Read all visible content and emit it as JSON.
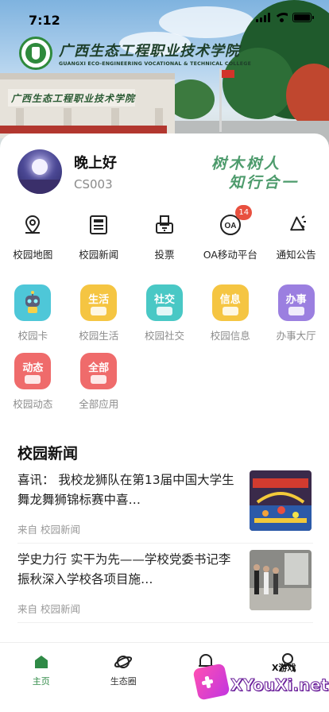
{
  "status_bar": {
    "time": "7:12"
  },
  "college": {
    "name_cn": "广西生态工程职业技术学院",
    "name_en": "GUANGXI ECO-ENGINEERING VOCATIONAL & TECHNICAL COLLEGE"
  },
  "profile": {
    "greeting": "晚上好",
    "user_id": "CS003",
    "motto_line1": "树木树人",
    "motto_line2": "知行合一"
  },
  "quick_links": [
    {
      "label": "校园地图",
      "icon": "map-pin-icon"
    },
    {
      "label": "校园新闻",
      "icon": "newspaper-icon"
    },
    {
      "label": "投票",
      "icon": "ballot-box-icon"
    },
    {
      "label": "OA移动平台",
      "icon": "oa-icon",
      "badge": "14"
    },
    {
      "label": "通知公告",
      "icon": "megaphone-icon"
    }
  ],
  "apps": [
    {
      "label": "校园卡",
      "tile_text": "",
      "color": "#4ec7d8",
      "icon": "robot-card-icon"
    },
    {
      "label": "校园生活",
      "tile_text": "生活",
      "color": "#f5c542",
      "icon": "life-icon"
    },
    {
      "label": "校园社交",
      "tile_text": "社交",
      "color": "#49c8c5",
      "icon": "social-icon"
    },
    {
      "label": "校园信息",
      "tile_text": "信息",
      "color": "#f5c542",
      "icon": "info-icon"
    },
    {
      "label": "办事大厅",
      "tile_text": "办事",
      "color": "#9b7fe0",
      "icon": "service-hall-icon"
    },
    {
      "label": "校园动态",
      "tile_text": "动态",
      "color": "#ef6b6b",
      "icon": "bell-icon"
    },
    {
      "label": "全部应用",
      "tile_text": "全部",
      "color": "#ef6b6b",
      "icon": "all-apps-icon"
    }
  ],
  "news": {
    "section_title": "校园新闻",
    "items": [
      {
        "headline": "喜讯： 我校龙狮队在第13届中国大学生舞龙舞狮锦标赛中喜…",
        "source": "来自 校园新闻"
      },
      {
        "headline": "学史力行 实干为先——学校党委书记李振秋深入学校各项目施…",
        "source": "来自 校园新闻"
      }
    ]
  },
  "tabs": [
    {
      "label": "主页",
      "icon": "home-icon",
      "active": true
    },
    {
      "label": "生态圈",
      "icon": "planet-icon",
      "active": false
    },
    {
      "label": "",
      "icon": "bell-icon",
      "active": false
    },
    {
      "label": "",
      "icon": "user-icon",
      "active": false
    }
  ],
  "colors": {
    "brand_green": "#2f8a46",
    "badge_red": "#e8503f"
  },
  "watermark": {
    "small_text": "X游戏",
    "big_text": "XYouXi.net"
  }
}
